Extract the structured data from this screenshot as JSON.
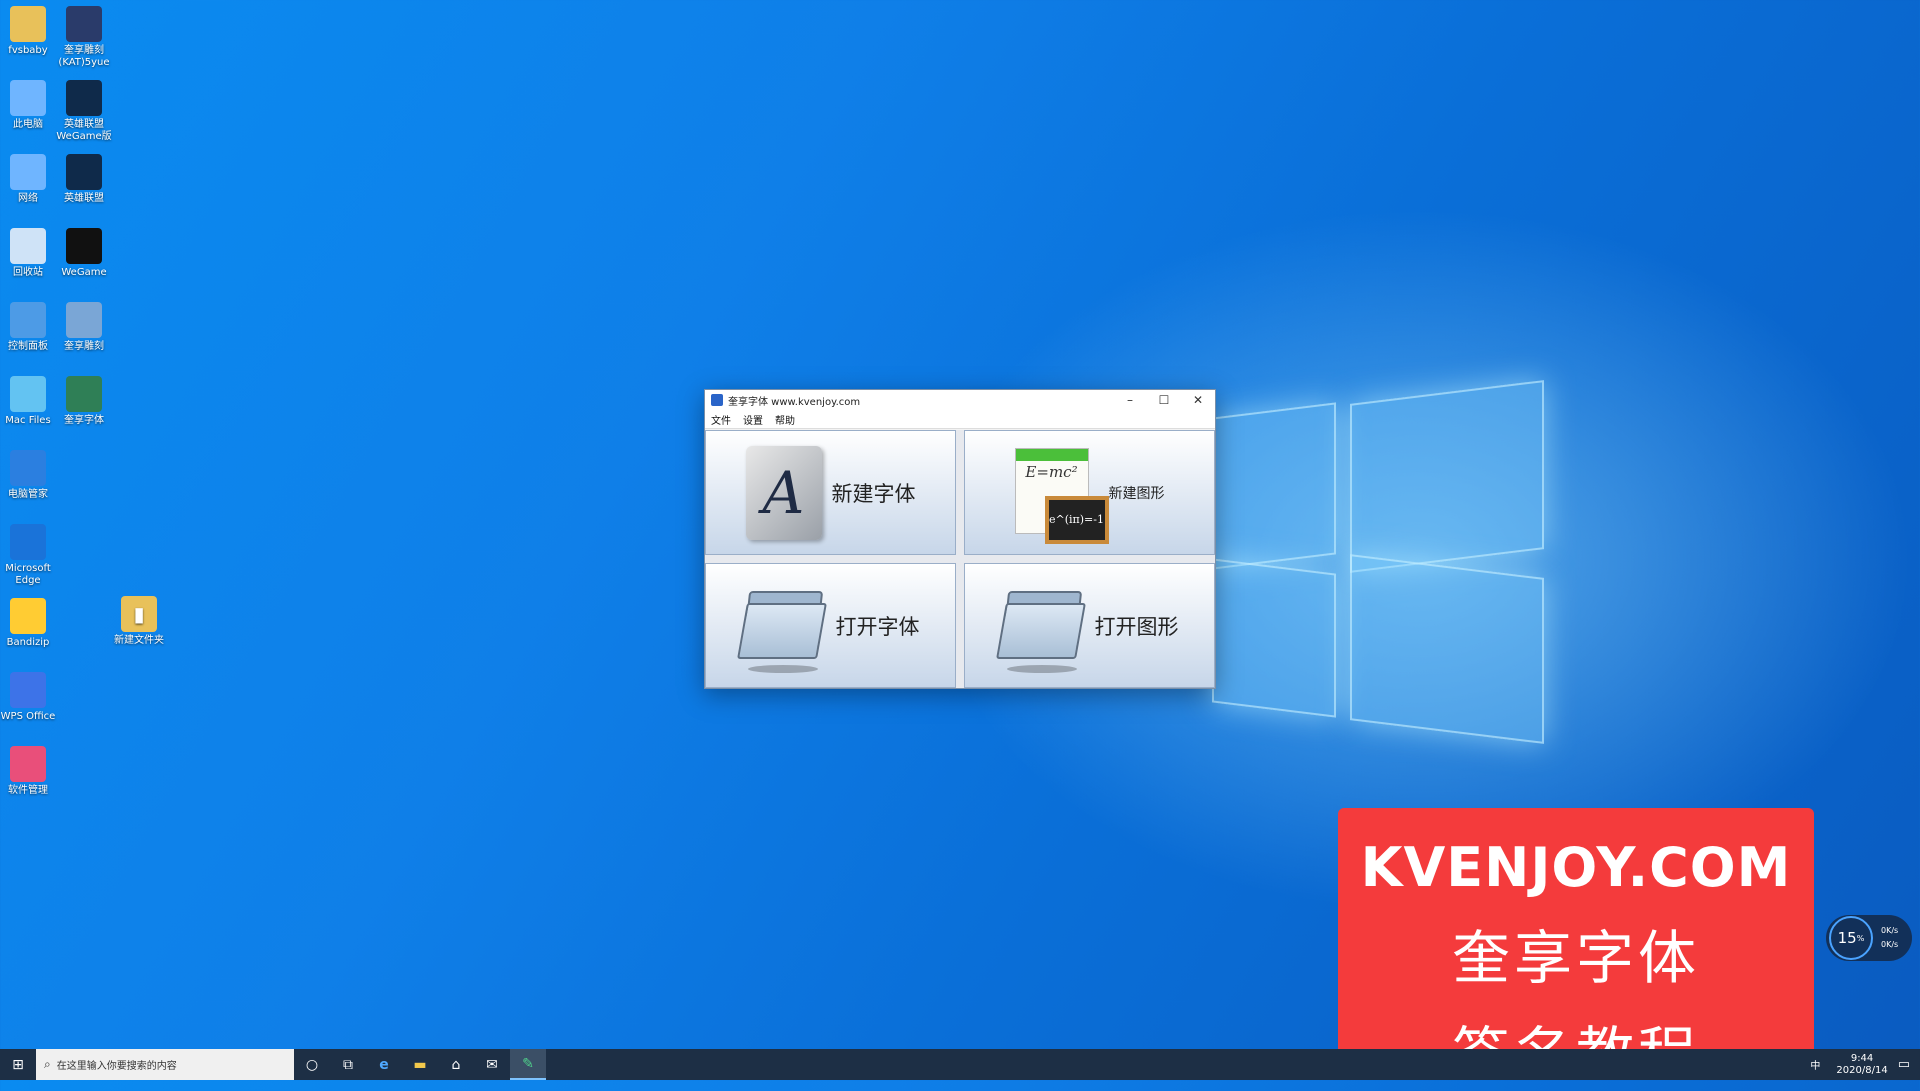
{
  "desktop": {
    "icons_col1": [
      {
        "label": "fvsbaby",
        "icon": "user-folder-icon",
        "color": "#e8c15a"
      },
      {
        "label": "此电脑",
        "icon": "computer-icon",
        "color": "#6fb5ff"
      },
      {
        "label": "网络",
        "icon": "network-icon",
        "color": "#6fb5ff"
      },
      {
        "label": "回收站",
        "icon": "recycle-bin-icon",
        "color": "#cfe3f7"
      },
      {
        "label": "控制面板",
        "icon": "control-panel-icon",
        "color": "#4d9be6"
      },
      {
        "label": "Mac Files",
        "icon": "mac-files-icon",
        "color": "#63c3f2"
      },
      {
        "label": "电脑管家",
        "icon": "shield-icon",
        "color": "#2b7fe0"
      },
      {
        "label": "Microsoft Edge",
        "icon": "edge-icon",
        "color": "#1a73d9"
      },
      {
        "label": "Bandizip",
        "icon": "bandizip-icon",
        "color": "#ffcc33"
      },
      {
        "label": "WPS Office",
        "icon": "wps-icon",
        "color": "#3d73e8"
      },
      {
        "label": "软件管理",
        "icon": "software-manager-icon",
        "color": "#e94f7a"
      }
    ],
    "icons_col2": [
      {
        "label": "奎享雕刻(KAT)5yue",
        "icon": "kat-icon",
        "color": "#2a3b6a"
      },
      {
        "label": "英雄联盟WeGame版",
        "icon": "lol-icon",
        "color": "#0f2a4a"
      },
      {
        "label": "英雄联盟",
        "icon": "lol-icon",
        "color": "#0f2a4a"
      },
      {
        "label": "WeGame",
        "icon": "wegame-icon",
        "color": "#111111"
      },
      {
        "label": "奎享雕刻",
        "icon": "kvenjoy-carve-icon",
        "color": "#7aa6d6"
      },
      {
        "label": "奎享字体",
        "icon": "kvenjoy-font-icon",
        "color": "#2f7f56"
      }
    ],
    "folder_icon": {
      "label": "新建文件夹",
      "icon": "folder-icon",
      "color": "#e8c15a"
    }
  },
  "window": {
    "title": "奎享字体 www.kvenjoy.com",
    "menu": [
      "文件",
      "设置",
      "帮助"
    ],
    "tiles": [
      {
        "label": "新建字体"
      },
      {
        "label": "新建图形"
      },
      {
        "label": "打开字体"
      },
      {
        "label": "打开图形"
      }
    ],
    "formula_text": "E=mc²",
    "board_text": "e^(iπ)=-1",
    "glyph_letter": "A"
  },
  "banner": {
    "line1": "KVENJOY.COM",
    "line2": "奎享字体",
    "line3": "签名教程"
  },
  "speed_widget": {
    "percent": "15",
    "unit": "%",
    "up": "0K/s",
    "down": "0K/s"
  },
  "taskbar": {
    "search_placeholder": "在这里输入你要搜索的内容",
    "ime": "中",
    "time": "9:44",
    "date": "2020/8/14"
  }
}
